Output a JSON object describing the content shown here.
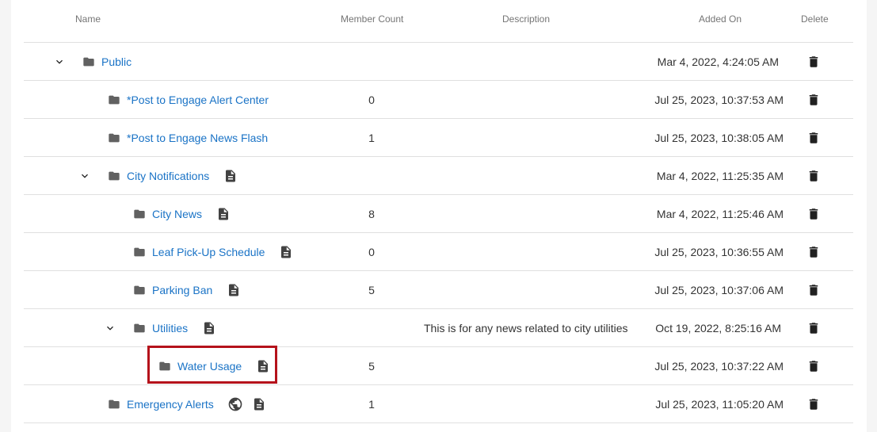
{
  "header": {
    "name": "Name",
    "member_count": "Member Count",
    "description": "Description",
    "added_on": "Added On",
    "delete": "Delete"
  },
  "rows": [
    {
      "name": "Public",
      "count": "",
      "description": "",
      "added_on": "Mar 4, 2022, 4:24:05 AM"
    },
    {
      "name": "*Post to Engage Alert Center",
      "count": "0",
      "description": "",
      "added_on": "Jul 25, 2023, 10:37:53 AM"
    },
    {
      "name": "*Post to Engage News Flash",
      "count": "1",
      "description": "",
      "added_on": "Jul 25, 2023, 10:38:05 AM"
    },
    {
      "name": "City Notifications",
      "count": "",
      "description": "",
      "added_on": "Mar 4, 2022, 11:25:35 AM"
    },
    {
      "name": "City News",
      "count": "8",
      "description": "",
      "added_on": "Mar 4, 2022, 11:25:46 AM"
    },
    {
      "name": "Leaf Pick-Up Schedule",
      "count": "0",
      "description": "",
      "added_on": "Jul 25, 2023, 10:36:55 AM"
    },
    {
      "name": "Parking Ban",
      "count": "5",
      "description": "",
      "added_on": "Jul 25, 2023, 10:37:06 AM"
    },
    {
      "name": "Utilities",
      "count": "",
      "description": "This is for any news related to city utilities",
      "added_on": "Oct 19, 2022, 8:25:16 AM"
    },
    {
      "name": "Water Usage",
      "count": "5",
      "description": "",
      "added_on": "Jul 25, 2023, 10:37:22 AM"
    },
    {
      "name": "Emergency Alerts",
      "count": "1",
      "description": "",
      "added_on": "Jul 25, 2023, 11:05:20 AM"
    }
  ],
  "icons": {
    "expand": "chevron-down-icon",
    "folder": "folder-icon",
    "note": "document-icon",
    "public": "globe-icon",
    "delete": "trash-icon"
  },
  "colors": {
    "link": "#1a73c6",
    "highlight": "#b5121b",
    "icon": "#616161",
    "trash": "#212121"
  }
}
